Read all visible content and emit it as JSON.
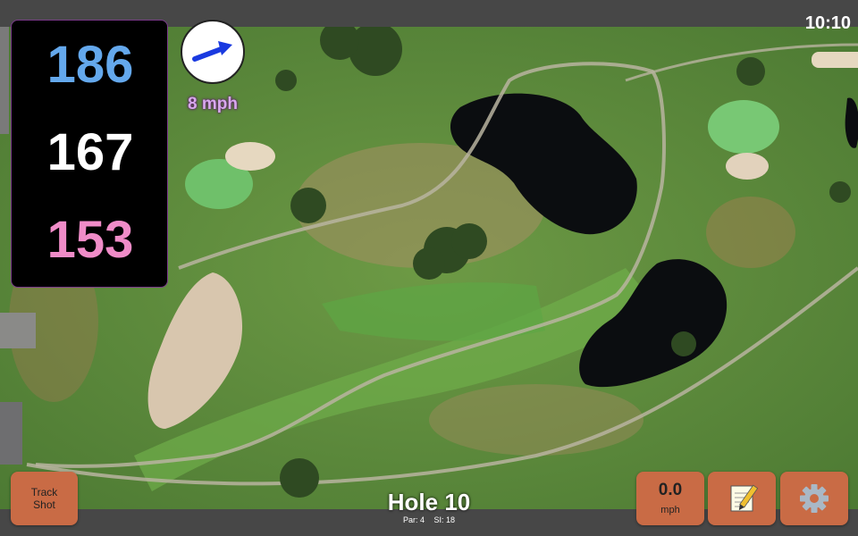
{
  "status": {
    "time": "10:10"
  },
  "distances": {
    "back": "186",
    "middle": "167",
    "front": "153"
  },
  "wind": {
    "speed": "8 mph",
    "icon": "wind-direction-arrow-icon"
  },
  "hole": {
    "title": "Hole 10",
    "par": "Par: 4",
    "stroke_index": "SI: 18"
  },
  "controls": {
    "track_shot_label": "Track\nShot",
    "speed_value": "0.0",
    "speed_unit": "mph",
    "notes_icon": "notepad-icon",
    "settings_icon": "gear-icon"
  },
  "colors": {
    "back": "#64a8ec",
    "middle": "#ffffff",
    "front": "#f08cc8",
    "wind_text": "#d7a8ec",
    "button": "#c96b45",
    "arrow": "#1a3ae0"
  }
}
